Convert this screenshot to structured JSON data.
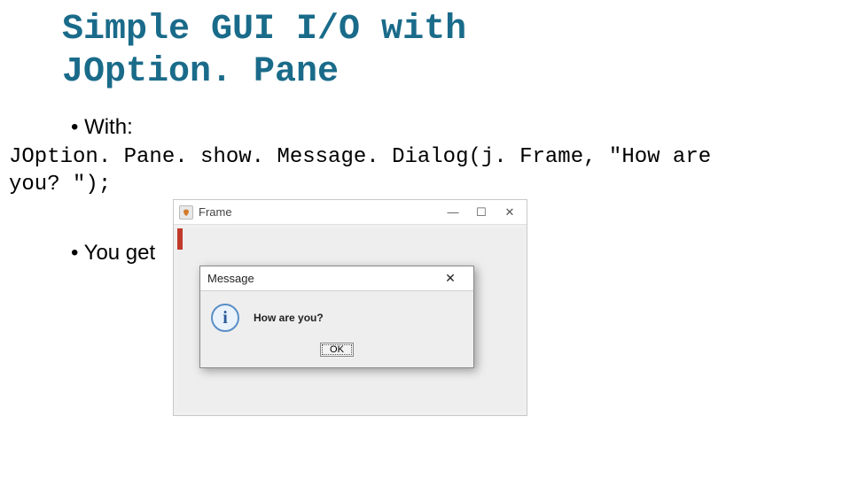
{
  "title": {
    "line1": "Simple GUI I/O with",
    "line2": "JOption. Pane"
  },
  "bullets": {
    "with_label": "• With:",
    "you_get_label": "• You get"
  },
  "code": {
    "line1": "JOption. Pane. show. Message. Dialog(j. Frame, \"How are",
    "line2": "you? \");"
  },
  "frame_window": {
    "title": "Frame",
    "controls": {
      "minimize": "—",
      "maximize": "☐",
      "close": "✕"
    }
  },
  "message_dialog": {
    "title": "Message",
    "close": "✕",
    "info_glyph": "i",
    "text": "How are you?",
    "ok_label": "OK"
  }
}
